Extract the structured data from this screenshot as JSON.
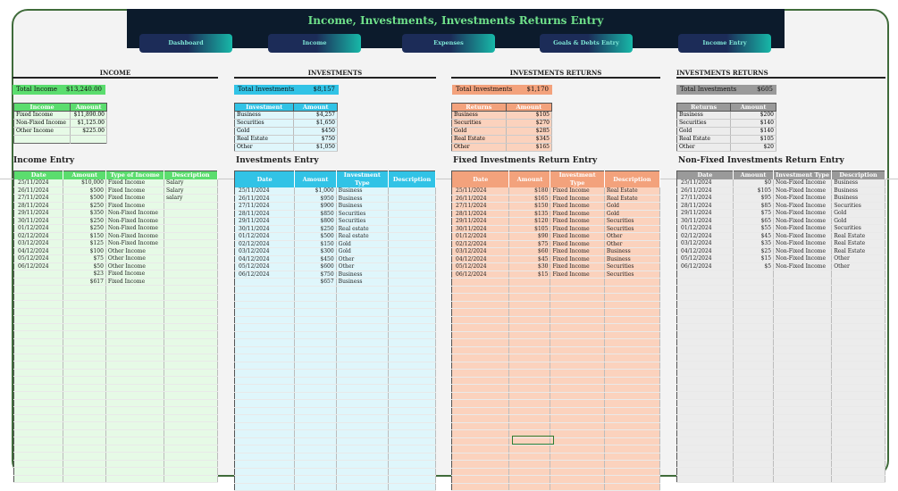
{
  "header": {
    "title": "Income, Investments, Investments Returns Entry"
  },
  "nav": [
    {
      "label": "Dashboard"
    },
    {
      "label": "Income"
    },
    {
      "label": "Expenses"
    },
    {
      "label": "Goals & Debts Entry"
    },
    {
      "label": "Income Entry"
    }
  ],
  "income": {
    "section_title": "INCOME",
    "total_label": "Total Income",
    "total_value": "$13,240.00",
    "summary_headers": [
      "Income",
      "Amount"
    ],
    "summary_rows": [
      [
        "Fixed Income",
        "$11,890.00"
      ],
      [
        "Non-Fixed Income",
        "$1,125.00"
      ],
      [
        "Other Income",
        "$225.00"
      ]
    ],
    "entry_title": "Income Entry",
    "entry_headers": [
      "Date",
      "Amount",
      "Type of Income",
      "Description"
    ],
    "entry_rows": [
      [
        "25/11/2024",
        "$10,000",
        "Fixed Income",
        "Salary"
      ],
      [
        "26/11/2024",
        "$500",
        "Fixed Income",
        "Salary"
      ],
      [
        "27/11/2024",
        "$500",
        "Fixed Income",
        "salary"
      ],
      [
        "28/11/2024",
        "$250",
        "Fixed Income",
        ""
      ],
      [
        "29/11/2024",
        "$350",
        "Non-Fixed Income",
        ""
      ],
      [
        "30/11/2024",
        "$250",
        "Non-Fixed Income",
        ""
      ],
      [
        "01/12/2024",
        "$250",
        "Non-Fixed Income",
        ""
      ],
      [
        "02/12/2024",
        "$150",
        "Non-Fixed Income",
        ""
      ],
      [
        "03/12/2024",
        "$125",
        "Non-Fixed Income",
        ""
      ],
      [
        "04/12/2024",
        "$100",
        "Other Income",
        ""
      ],
      [
        "05/12/2024",
        "$75",
        "Other Income",
        ""
      ],
      [
        "06/12/2024",
        "$50",
        "Other Income",
        ""
      ],
      [
        "",
        "$23",
        "Fixed Income",
        ""
      ],
      [
        "",
        "$617",
        "Fixed Income",
        ""
      ]
    ]
  },
  "investments": {
    "section_title": "INVESTMENTS",
    "total_label": "Total Investments",
    "total_value": "$8,157",
    "summary_headers": [
      "Investment",
      "Amount"
    ],
    "summary_rows": [
      [
        "Business",
        "$4,257"
      ],
      [
        "Securities",
        "$1,650"
      ],
      [
        "Gold",
        "$450"
      ],
      [
        "Real Estate",
        "$750"
      ],
      [
        "Other",
        "$1,050"
      ]
    ],
    "entry_title": "Investments Entry",
    "entry_headers": [
      "Date",
      "Amount",
      "Investment Type",
      "Description"
    ],
    "entry_rows": [
      [
        "25/11/2024",
        "$1,000",
        "Business",
        ""
      ],
      [
        "26/11/2024",
        "$950",
        "Business",
        ""
      ],
      [
        "27/11/2024",
        "$900",
        "Business",
        ""
      ],
      [
        "28/11/2024",
        "$850",
        "Securities",
        ""
      ],
      [
        "29/11/2024",
        "$800",
        "Securities",
        ""
      ],
      [
        "30/11/2024",
        "$250",
        "Real estate",
        ""
      ],
      [
        "01/12/2024",
        "$500",
        "Real estate",
        ""
      ],
      [
        "02/12/2024",
        "$150",
        "Gold",
        ""
      ],
      [
        "03/12/2024",
        "$300",
        "Gold",
        ""
      ],
      [
        "04/12/2024",
        "$450",
        "Other",
        ""
      ],
      [
        "05/12/2024",
        "$600",
        "Other",
        ""
      ],
      [
        "06/12/2024",
        "$750",
        "Business",
        ""
      ],
      [
        "",
        "$657",
        "Business",
        ""
      ]
    ]
  },
  "fixed_returns": {
    "section_title": "INVESTMENTS RETURNS",
    "total_label": "Total Investments",
    "total_value": "$1,170",
    "summary_headers": [
      "Returns",
      "Amount"
    ],
    "summary_rows": [
      [
        "Business",
        "$105"
      ],
      [
        "Securities",
        "$270"
      ],
      [
        "Gold",
        "$285"
      ],
      [
        "Real Estate",
        "$345"
      ],
      [
        "Other",
        "$165"
      ]
    ],
    "entry_title": "Fixed Investments Return Entry",
    "entry_headers": [
      "Date",
      "Amount",
      "Investment Type",
      "Description"
    ],
    "entry_rows": [
      [
        "25/11/2024",
        "$180",
        "Fixed Income",
        "Real Estate"
      ],
      [
        "26/11/2024",
        "$165",
        "Fixed Income",
        "Real Estate"
      ],
      [
        "27/11/2024",
        "$150",
        "Fixed Income",
        "Gold"
      ],
      [
        "28/11/2024",
        "$135",
        "Fixed Income",
        "Gold"
      ],
      [
        "29/11/2024",
        "$120",
        "Fixed Income",
        "Securities"
      ],
      [
        "30/11/2024",
        "$105",
        "Fixed Income",
        "Securities"
      ],
      [
        "01/12/2024",
        "$90",
        "Fixed Income",
        "Other"
      ],
      [
        "02/12/2024",
        "$75",
        "Fixed Income",
        "Other"
      ],
      [
        "03/12/2024",
        "$60",
        "Fixed Income",
        "Business"
      ],
      [
        "04/12/2024",
        "$45",
        "Fixed Income",
        "Business"
      ],
      [
        "05/12/2024",
        "$30",
        "Fixed Income",
        "Securities"
      ],
      [
        "06/12/2024",
        "$15",
        "Fixed Income",
        "Securities"
      ]
    ]
  },
  "nonfixed_returns": {
    "section_title": "INVESTMENTS RETURNS",
    "total_label": "Total Investments",
    "total_value": "$605",
    "summary_headers": [
      "Returns",
      "Amount"
    ],
    "summary_rows": [
      [
        "Business",
        "$200"
      ],
      [
        "Securities",
        "$140"
      ],
      [
        "Gold",
        "$140"
      ],
      [
        "Real Estate",
        "$105"
      ],
      [
        "Other",
        "$20"
      ]
    ],
    "entry_title": "Non-Fixed Investments Return Entry",
    "entry_headers": [
      "Date",
      "Amount",
      "Investment Type",
      "Description"
    ],
    "entry_rows": [
      [
        "25/11/2024",
        "$0",
        "Non-Fixed Income",
        "Business"
      ],
      [
        "26/11/2024",
        "$105",
        "Non-Fixed Income",
        "Business"
      ],
      [
        "27/11/2024",
        "$95",
        "Non-Fixed Income",
        "Business"
      ],
      [
        "28/11/2024",
        "$85",
        "Non-Fixed Income",
        "Securities"
      ],
      [
        "29/11/2024",
        "$75",
        "Non-Fixed Income",
        "Gold"
      ],
      [
        "30/11/2024",
        "$65",
        "Non-Fixed Income",
        "Gold"
      ],
      [
        "01/12/2024",
        "$55",
        "Non-Fixed Income",
        "Securities"
      ],
      [
        "02/12/2024",
        "$45",
        "Non-Fixed Income",
        "Real Estate"
      ],
      [
        "03/12/2024",
        "$35",
        "Non-Fixed Income",
        "Real Estate"
      ],
      [
        "04/12/2024",
        "$25",
        "Non-Fixed Income",
        "Real Estate"
      ],
      [
        "05/12/2024",
        "$15",
        "Non-Fixed Income",
        "Other"
      ],
      [
        "06/12/2024",
        "$5",
        "Non-Fixed Income",
        "Other"
      ]
    ]
  },
  "colors": {
    "income": "#5bdd6e",
    "income_light": "#e6fae6",
    "investments": "#31c3e6",
    "investments_light": "#dff6fb",
    "fixed": "#f3a27c",
    "fixed_light": "#fbd2bd",
    "nonfixed": "#9a9a9a",
    "nonfixed_light": "#ececec"
  }
}
